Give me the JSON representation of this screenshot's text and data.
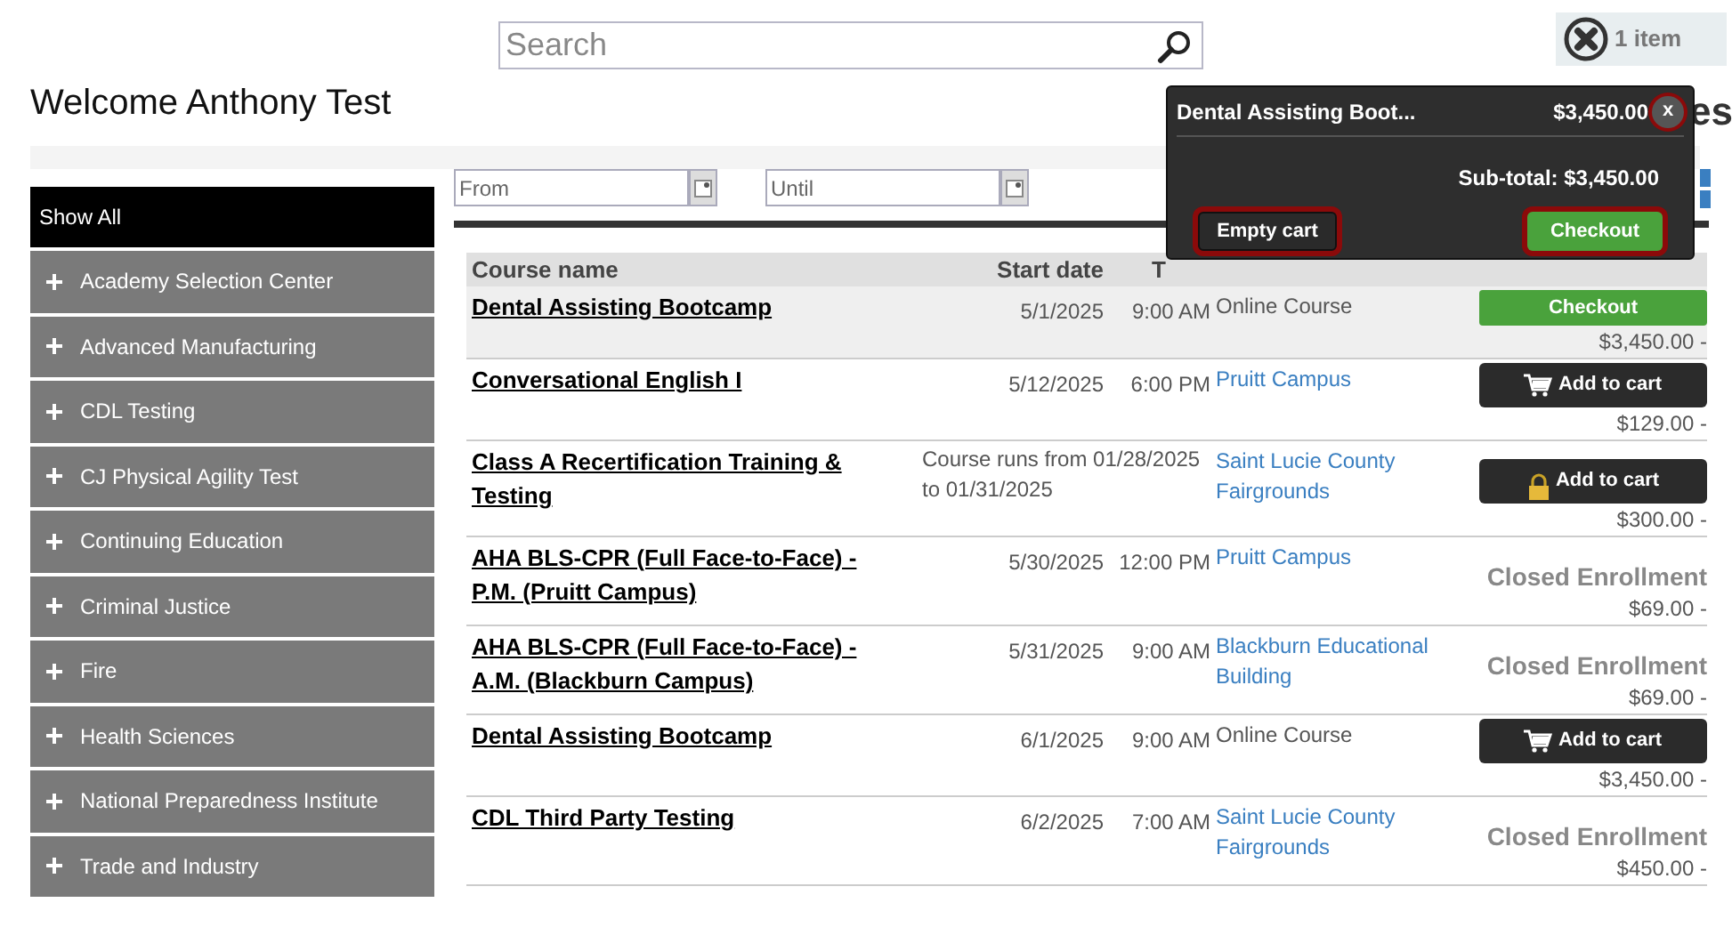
{
  "search": {
    "placeholder": "Search"
  },
  "cart": {
    "count_label": "1 item"
  },
  "welcome": "Welcome Anthony Test",
  "hidden_heading": "es",
  "date_filter": {
    "from": {
      "placeholder": "From"
    },
    "until": {
      "placeholder": "Until"
    }
  },
  "sidebar": {
    "items": [
      {
        "label": "Show All",
        "selected": true,
        "kind": "all"
      },
      {
        "label": "Academy Selection Center",
        "selected": false,
        "kind": "category",
        "expanded": false
      },
      {
        "label": "Advanced Manufacturing",
        "selected": false,
        "kind": "category",
        "expanded": false
      },
      {
        "label": "CDL Testing",
        "selected": false,
        "kind": "category",
        "expanded": false
      },
      {
        "label": "CJ Physical Agility Test",
        "selected": false,
        "kind": "category",
        "expanded": false
      },
      {
        "label": "Continuing Education",
        "selected": false,
        "kind": "category",
        "expanded": false
      },
      {
        "label": "Criminal Justice",
        "selected": false,
        "kind": "category",
        "expanded": false
      },
      {
        "label": "Fire",
        "selected": false,
        "kind": "category",
        "expanded": false
      },
      {
        "label": "Health Sciences",
        "selected": false,
        "kind": "category",
        "expanded": false
      },
      {
        "label": "National Preparedness Institute",
        "selected": false,
        "kind": "category",
        "expanded": false
      },
      {
        "label": "Trade and Industry",
        "selected": false,
        "kind": "category",
        "expanded": false
      }
    ]
  },
  "table": {
    "columns": [
      "Course name",
      "Start date",
      "T"
    ],
    "rows": [
      {
        "name": "Dental Assisting Bootcamp",
        "date": "5/1/2025",
        "time": "9:00 AM",
        "location": "Online Course",
        "location_link": false,
        "in_cart": true,
        "action": {
          "kind": "checkout",
          "label": "Checkout"
        },
        "price": "$3,450.00 -"
      },
      {
        "name": "Conversational English I",
        "date": "5/12/2025",
        "time": "6:00 PM",
        "location": "Pruitt Campus",
        "location_link": true,
        "in_cart": false,
        "action": {
          "kind": "add",
          "label": "Add to cart"
        },
        "price": "$129.00 -"
      },
      {
        "name": "Class A Recertification Training & Testing",
        "date": "Course runs from 01/28/2025 to 01/31/2025",
        "location": "Saint Lucie County Fairgrounds",
        "location_link": true,
        "in_cart": false,
        "action": {
          "kind": "locked",
          "label": "Add to cart"
        },
        "price": "$300.00 -"
      },
      {
        "name": "AHA BLS-CPR (Full Face-to-Face) - P.M. (Pruitt Campus)",
        "date": "5/30/2025",
        "time": "12:00 PM",
        "location": "Pruitt Campus",
        "location_link": true,
        "in_cart": false,
        "action": {
          "kind": "closed",
          "label": "Closed Enrollment"
        },
        "price": "$69.00 -"
      },
      {
        "name": "AHA BLS-CPR (Full Face-to-Face) - A.M. (Blackburn Campus)",
        "date": "5/31/2025",
        "time": "9:00 AM",
        "location": "Blackburn Educational Building",
        "location_link": true,
        "in_cart": false,
        "action": {
          "kind": "closed",
          "label": "Closed Enrollment"
        },
        "price": "$69.00 -"
      },
      {
        "name": "Dental Assisting Bootcamp",
        "date": "6/1/2025",
        "time": "9:00 AM",
        "location": "Online Course",
        "location_link": false,
        "in_cart": false,
        "action": {
          "kind": "add",
          "label": "Add to cart"
        },
        "price": "$3,450.00 -"
      },
      {
        "name": "CDL Third Party Testing",
        "date": "6/2/2025",
        "time": "7:00 AM",
        "location": "Saint Lucie County Fairgrounds",
        "location_link": true,
        "in_cart": false,
        "action": {
          "kind": "closed",
          "label": "Closed Enrollment"
        },
        "price": "$450.00 -"
      }
    ]
  },
  "cart_popup": {
    "item": {
      "name": "Dental Assisting Boot...",
      "price": "$3,450.00",
      "close_label": "x",
      "close_highlighted": true
    },
    "subtotal": "Sub-total: $3,450.00",
    "buttons": [
      {
        "kind": "empty",
        "label": "Empty cart",
        "highlighted": true
      },
      {
        "kind": "checkout",
        "label": "Checkout",
        "highlighted": true
      }
    ]
  }
}
